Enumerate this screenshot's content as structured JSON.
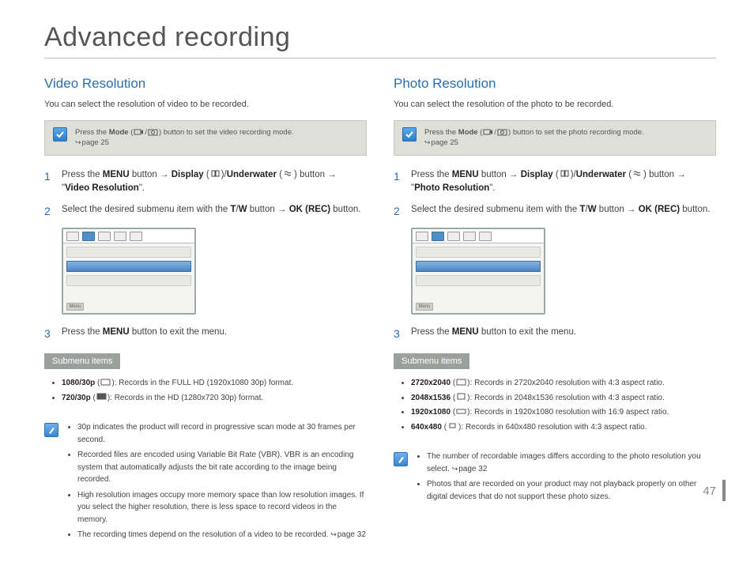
{
  "page": {
    "title": "Advanced recording",
    "number": "47"
  },
  "left": {
    "heading": "Video Resolution",
    "intro": "You can select the resolution of video to be recorded.",
    "callout": {
      "prefix": "Press the ",
      "mode_label": "Mode",
      "suffix": " button to set the video recording mode.",
      "ref": "page 25"
    },
    "steps": {
      "s1a": "Press the ",
      "s1_menu": "MENU",
      "s1b": " button ",
      "s1_display": "Display",
      "s1_underwater": "Underwater",
      "s1c": " button ",
      "s1_target": "Video Resolution",
      "s2a": "Select the desired submenu item with the ",
      "s2_tw": "T",
      "s2_slash": "/",
      "s2_w": "W",
      "s2b": " button ",
      "s2_ok": "OK (REC)",
      "s2c": " button.",
      "s3a": "Press the ",
      "s3_menu": "MENU",
      "s3b": " button to exit the menu."
    },
    "submenu_label": "Submenu items",
    "submenu_items": [
      {
        "name": "1080/30p",
        "desc": ": Records in the FULL HD (1920x1080 30p) format."
      },
      {
        "name": "720/30p",
        "desc": ": Records in the HD (1280x720 30p) format."
      }
    ],
    "notes": [
      "30p indicates the product will record in progressive scan mode at 30 frames per second.",
      "Recorded files are encoded using Variable Bit Rate (VBR). VBR is an encoding system that automatically adjusts the bit rate according to the image being recorded.",
      "High resolution images occupy more memory space than low resolution images. If you select the higher resolution, there is less space to record videos in the memory.",
      "The recording times depend on the resolution of a video to be recorded. "
    ],
    "notes_ref": "page 32"
  },
  "right": {
    "heading": "Photo Resolution",
    "intro": "You can select the resolution of the photo to be recorded.",
    "callout": {
      "prefix": "Press the ",
      "mode_label": "Mode",
      "suffix": " button to set the photo recording mode.",
      "ref": "page 25"
    },
    "steps": {
      "s1a": "Press the ",
      "s1_menu": "MENU",
      "s1b": " button ",
      "s1_display": "Display",
      "s1_underwater": "Underwater",
      "s1c": " button ",
      "s1_target": "Photo Resolution",
      "s2a": "Select the desired submenu item with the ",
      "s2_tw": "T",
      "s2_slash": "/",
      "s2_w": "W",
      "s2b": " button ",
      "s2_ok": "OK (REC)",
      "s2c": " button.",
      "s3a": "Press the ",
      "s3_menu": "MENU",
      "s3b": " button to exit the menu."
    },
    "submenu_label": "Submenu items",
    "submenu_items": [
      {
        "name": "2720x2040",
        "desc": ": Records in 2720x2040 resolution with 4:3 aspect ratio."
      },
      {
        "name": "2048x1536",
        "desc": ": Records in 2048x1536 resolution with 4:3 aspect ratio."
      },
      {
        "name": "1920x1080",
        "desc": ": Records in 1920x1080 resolution with 16:9 aspect ratio."
      },
      {
        "name": "640x480",
        "desc": ": Records in 640x480 resolution with 4:3 aspect ratio."
      }
    ],
    "notes": [
      "The number of recordable images differs according to the photo resolution you select. ",
      "Photos that are recorded on your product may not playback properly on other digital devices that do not support these photo sizes."
    ],
    "notes_ref": "page 32"
  }
}
